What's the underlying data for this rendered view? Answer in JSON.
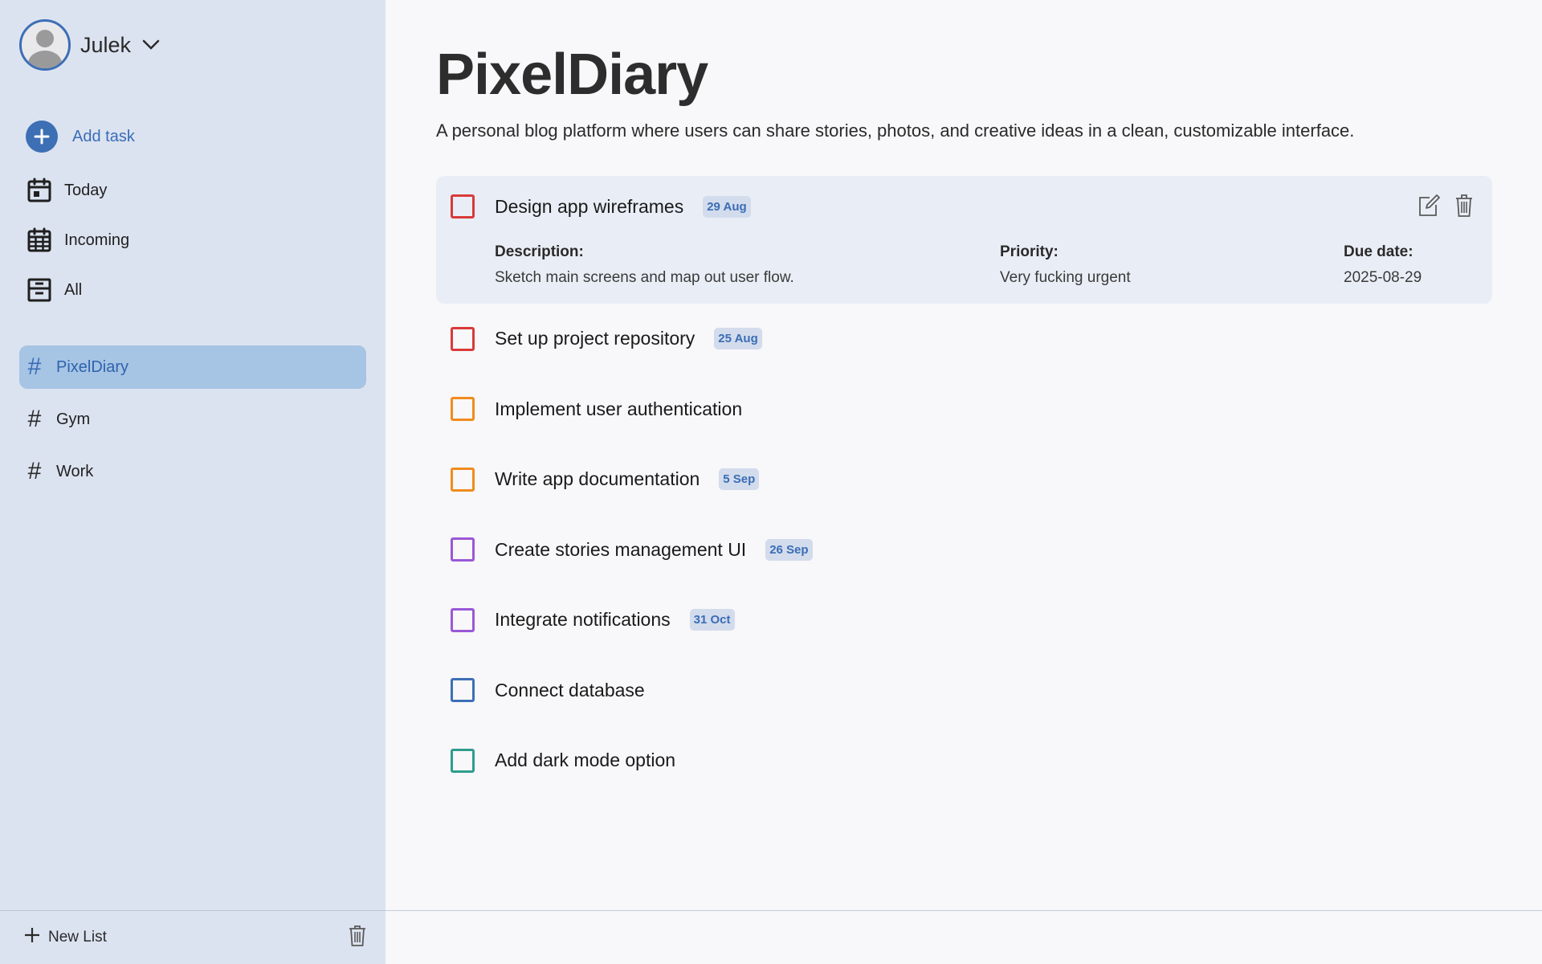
{
  "user": {
    "name": "Julek"
  },
  "nav": {
    "add_task": "Add task",
    "items": [
      {
        "label": "Today",
        "icon": "calendar-today-icon"
      },
      {
        "label": "Incoming",
        "icon": "calendar-grid-icon"
      },
      {
        "label": "All",
        "icon": "archive-icon"
      }
    ]
  },
  "lists": {
    "items": [
      {
        "label": "PixelDiary",
        "active": true
      },
      {
        "label": "Gym",
        "active": false
      },
      {
        "label": "Work",
        "active": false
      }
    ]
  },
  "footer": {
    "new_list": "New List"
  },
  "main": {
    "title": "PixelDiary",
    "subtitle": "A personal blog platform where users can share stories, photos, and creative ideas in a clean, customizable interface.",
    "expanded_task": {
      "title": "Design app wireframes",
      "badge": "29 Aug",
      "priority_color": "#d93a3a",
      "description_label": "Description:",
      "description": "Sketch main screens and map out user flow.",
      "priority_label": "Priority:",
      "priority": "Very fucking urgent",
      "due_label": "Due date:",
      "due": "2025-08-29"
    },
    "tasks": [
      {
        "title": "Set up project repository",
        "badge": "25 Aug",
        "color": "#d93a3a"
      },
      {
        "title": "Implement user authentication",
        "badge": "",
        "color": "#f08c1e"
      },
      {
        "title": "Write app documentation",
        "badge": "5 Sep",
        "color": "#f08c1e"
      },
      {
        "title": "Create stories management UI",
        "badge": "26 Sep",
        "color": "#9a58d6"
      },
      {
        "title": "Integrate notifications",
        "badge": "31 Oct",
        "color": "#9a58d6"
      },
      {
        "title": "Connect database",
        "badge": "",
        "color": "#3d6fb5"
      },
      {
        "title": "Add dark mode option",
        "badge": "",
        "color": "#2f9c8e"
      }
    ]
  },
  "colors": {
    "accent": "#3d6fb5",
    "sidebar_bg": "#dce3f0",
    "active_list_bg": "#a6c4e4"
  }
}
